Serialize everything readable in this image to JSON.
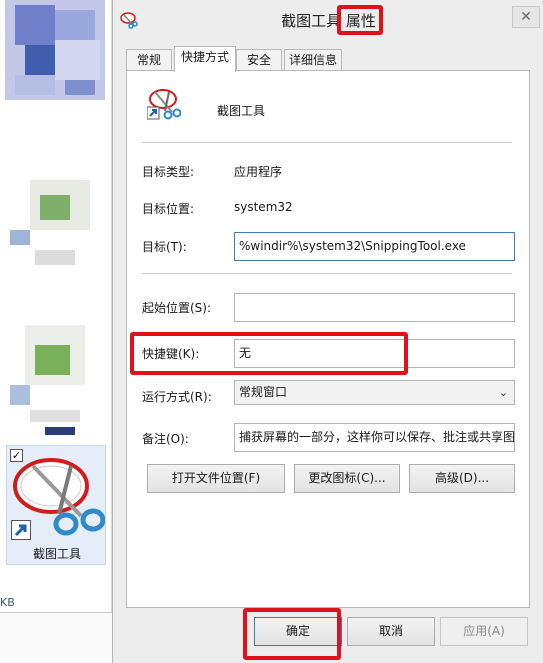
{
  "dialog": {
    "title": "截图工具 属性",
    "tabs": [
      {
        "label": "常规"
      },
      {
        "label": "快捷方式"
      },
      {
        "label": "安全"
      },
      {
        "label": "详细信息"
      }
    ],
    "app_name": "截图工具",
    "target_type_label": "目标类型:",
    "target_type_value": "应用程序",
    "target_location_label": "目标位置:",
    "target_location_value": "system32",
    "target_label": "目标(T):",
    "target_value": "%windir%\\system32\\SnippingTool.exe",
    "start_in_label": "起始位置(S):",
    "start_in_value": "",
    "hotkey_label": "快捷键(K):",
    "hotkey_value": "无",
    "run_label": "运行方式(R):",
    "run_value": "常规窗口",
    "comment_label": "备注(O):",
    "comment_value": "捕获屏幕的一部分，这样你可以保存、批注或共享图",
    "open_location_button": "打开文件位置(F)",
    "change_icon_button": "更改图标(C)...",
    "advanced_button": "高级(D)...",
    "ok_button": "确定",
    "cancel_button": "取消",
    "apply_button": "应用(A)",
    "close_glyph": "✕"
  },
  "explorer": {
    "selected_file_label": "截图工具",
    "checkbox_glyph": "✓",
    "size_text": "KB"
  },
  "colors": {
    "highlight": "#e0101c",
    "dialog_bg": "#ededed",
    "panel_bg": "#ffffff"
  }
}
